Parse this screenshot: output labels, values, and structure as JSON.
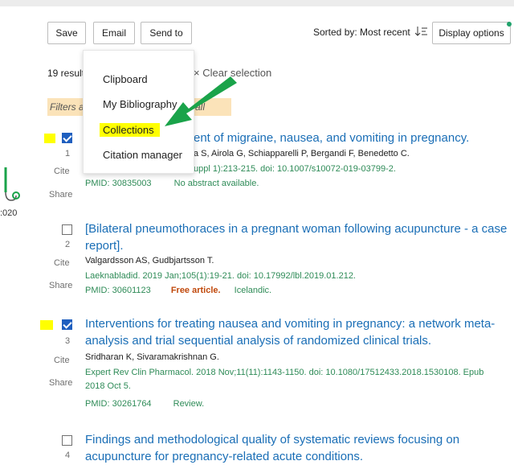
{
  "toolbar": {
    "save_label": "Save",
    "email_label": "Email",
    "send_to_label": "Send to",
    "sorted_by": "Sorted by: Most recent",
    "sort_icon": "sort-descending-icon",
    "display_options_label": "Display options"
  },
  "results": {
    "count_text": "19 result",
    "clear_selection": "Clear selection",
    "filters_label": "Filters a",
    "filters_all": "all"
  },
  "left_fragment": {
    "year": ":020"
  },
  "send_to_menu": {
    "items": [
      {
        "label": "Clipboard"
      },
      {
        "label": "My Bibliography"
      },
      {
        "label": "Collections"
      },
      {
        "label": "Citation manager"
      }
    ],
    "highlighted": "Collections"
  },
  "articles": [
    {
      "number": "1",
      "checked": true,
      "title": "ent of migraine, nausea, and vomiting in pregnancy.",
      "authors": "a S, Airola G, Schiapparelli P, Bergandi F, Benedetto C.",
      "journal": "uppl 1):213-215. doi: 10.1007/s10072-019-03799-2.",
      "pmid": "PMID: 30835003",
      "note": "No abstract available.",
      "cite": "Cite",
      "share": "Share"
    },
    {
      "number": "2",
      "checked": false,
      "title_line1": "[Bilateral pneumothoraces in a pregnant woman following acupuncture - a case",
      "title_line2": "report].",
      "authors": "Valgardsson AS, Gudbjartsson T.",
      "journal": "Laeknabladid. 2019 Jan;105(1):19-21. doi: 10.17992/lbl.2019.01.212.",
      "pmid": "PMID: 30601123",
      "free": "Free article.",
      "lang": "Icelandic.",
      "cite": "Cite",
      "share": "Share"
    },
    {
      "number": "3",
      "checked": true,
      "title_line1": "Interventions for treating nausea and vomiting in pregnancy: a network meta-",
      "title_line2": "analysis and trial sequential analysis of randomized clinical trials.",
      "authors": "Sridharan K, Sivaramakrishnan G.",
      "journal_line1": "Expert Rev Clin Pharmacol. 2018 Nov;11(11):1143-1150. doi: 10.1080/17512433.2018.1530108. Epub",
      "journal_line2": "2018 Oct 5.",
      "pmid": "PMID: 30261764",
      "note": "Review.",
      "cite": "Cite",
      "share": "Share"
    },
    {
      "number": "4",
      "checked": false,
      "title_line1": "Findings and methodological quality of systematic reviews focusing on",
      "title_line2": "acupuncture for pregnancy-related acute conditions."
    }
  ],
  "colors": {
    "link": "#1a6eb6",
    "journal": "#2e8b57",
    "checkbox": "#1f5fbf",
    "highlight": "#ffff00",
    "annotation_arrow": "#1aa34a",
    "free_article": "#c0490c"
  }
}
